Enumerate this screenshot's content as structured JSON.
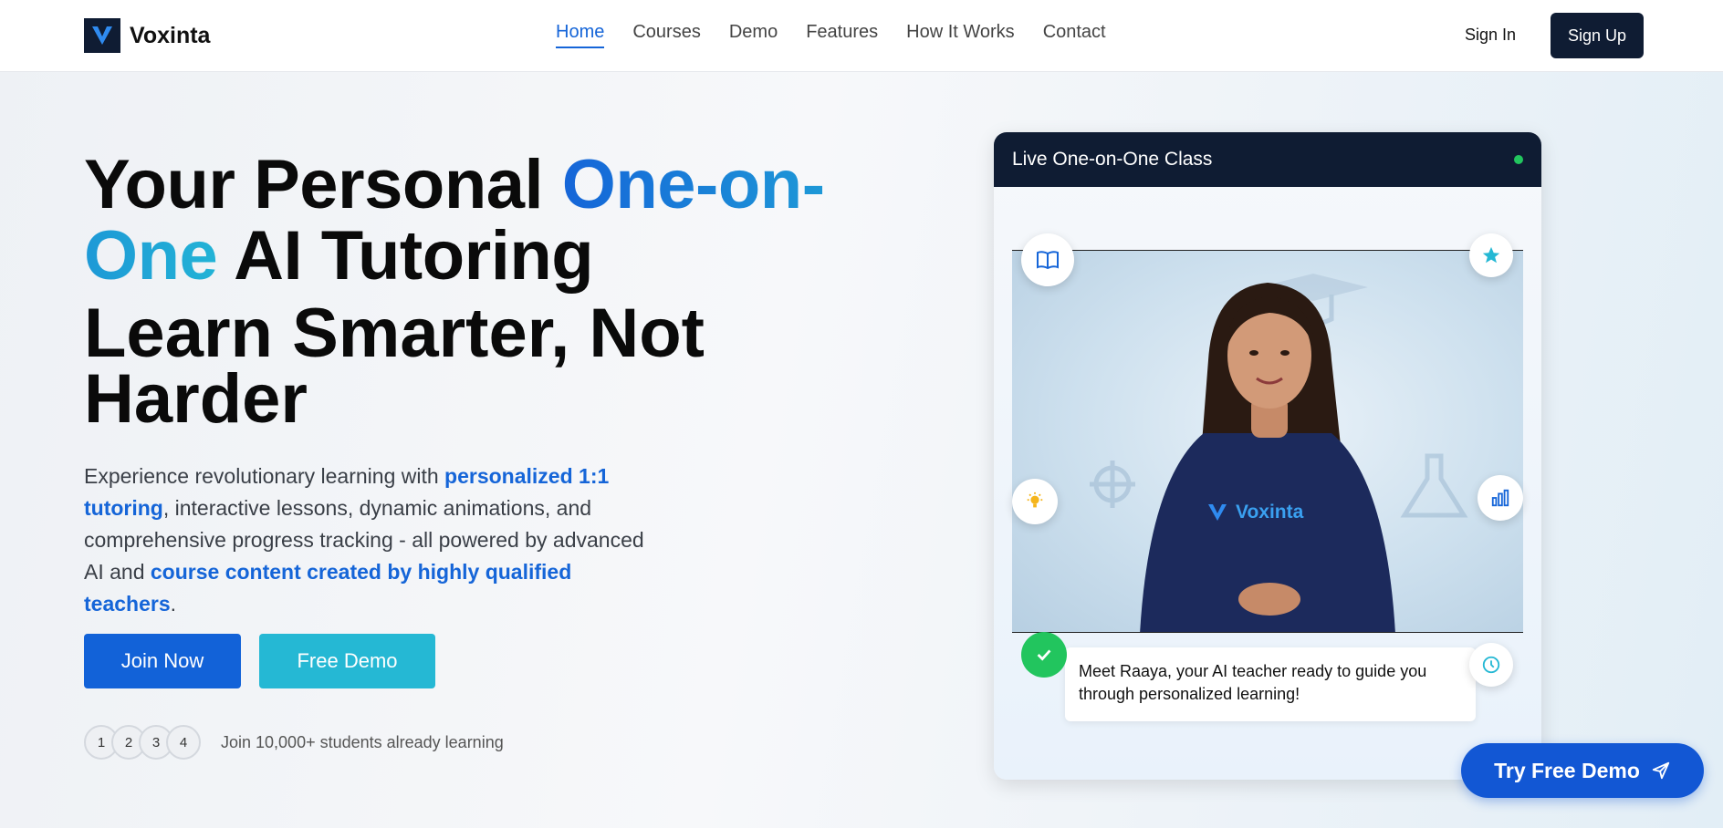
{
  "brand": {
    "name": "Voxinta",
    "logo_letter": "V",
    "primary_color": "#1565d8",
    "dark_color": "#0f1c33",
    "accent_color": "#25b8d4"
  },
  "nav": {
    "items": [
      {
        "label": "Home",
        "active": true
      },
      {
        "label": "Courses",
        "active": false
      },
      {
        "label": "Demo",
        "active": false
      },
      {
        "label": "Features",
        "active": false
      },
      {
        "label": "How It Works",
        "active": false
      },
      {
        "label": "Contact",
        "active": false
      }
    ],
    "sign_in": "Sign In",
    "sign_up": "Sign Up"
  },
  "hero": {
    "title_prefix": "Your Personal ",
    "title_highlight": "One-on-One",
    "title_suffix": " AI Tutoring",
    "subtitle": "Learn Smarter, Not Harder",
    "desc_part1": "Experience revolutionary learning with ",
    "desc_hl1": "personalized 1:1 tutoring",
    "desc_part2": ", interactive lessons, dynamic animations, and comprehensive progress tracking - all powered by advanced AI and ",
    "desc_hl2": "course content created by highly qualified teachers",
    "desc_part3": ".",
    "join_button": "Join Now",
    "demo_button": "Free Demo",
    "avatars": [
      "1",
      "2",
      "3",
      "4"
    ],
    "students_text": "Join 10,000+ students already learning"
  },
  "live_class": {
    "title": "Live One-on-One Class",
    "status": "live",
    "tshirt_text": "Voxinta",
    "message": "Meet Raaya, your AI teacher ready to guide you through personalized learning!",
    "icons": [
      "book-icon",
      "star-icon",
      "lightbulb-icon",
      "bar-chart-icon",
      "clock-icon",
      "check-icon"
    ]
  },
  "cta": {
    "try_demo": "Try Free Demo",
    "icon": "send-icon"
  }
}
